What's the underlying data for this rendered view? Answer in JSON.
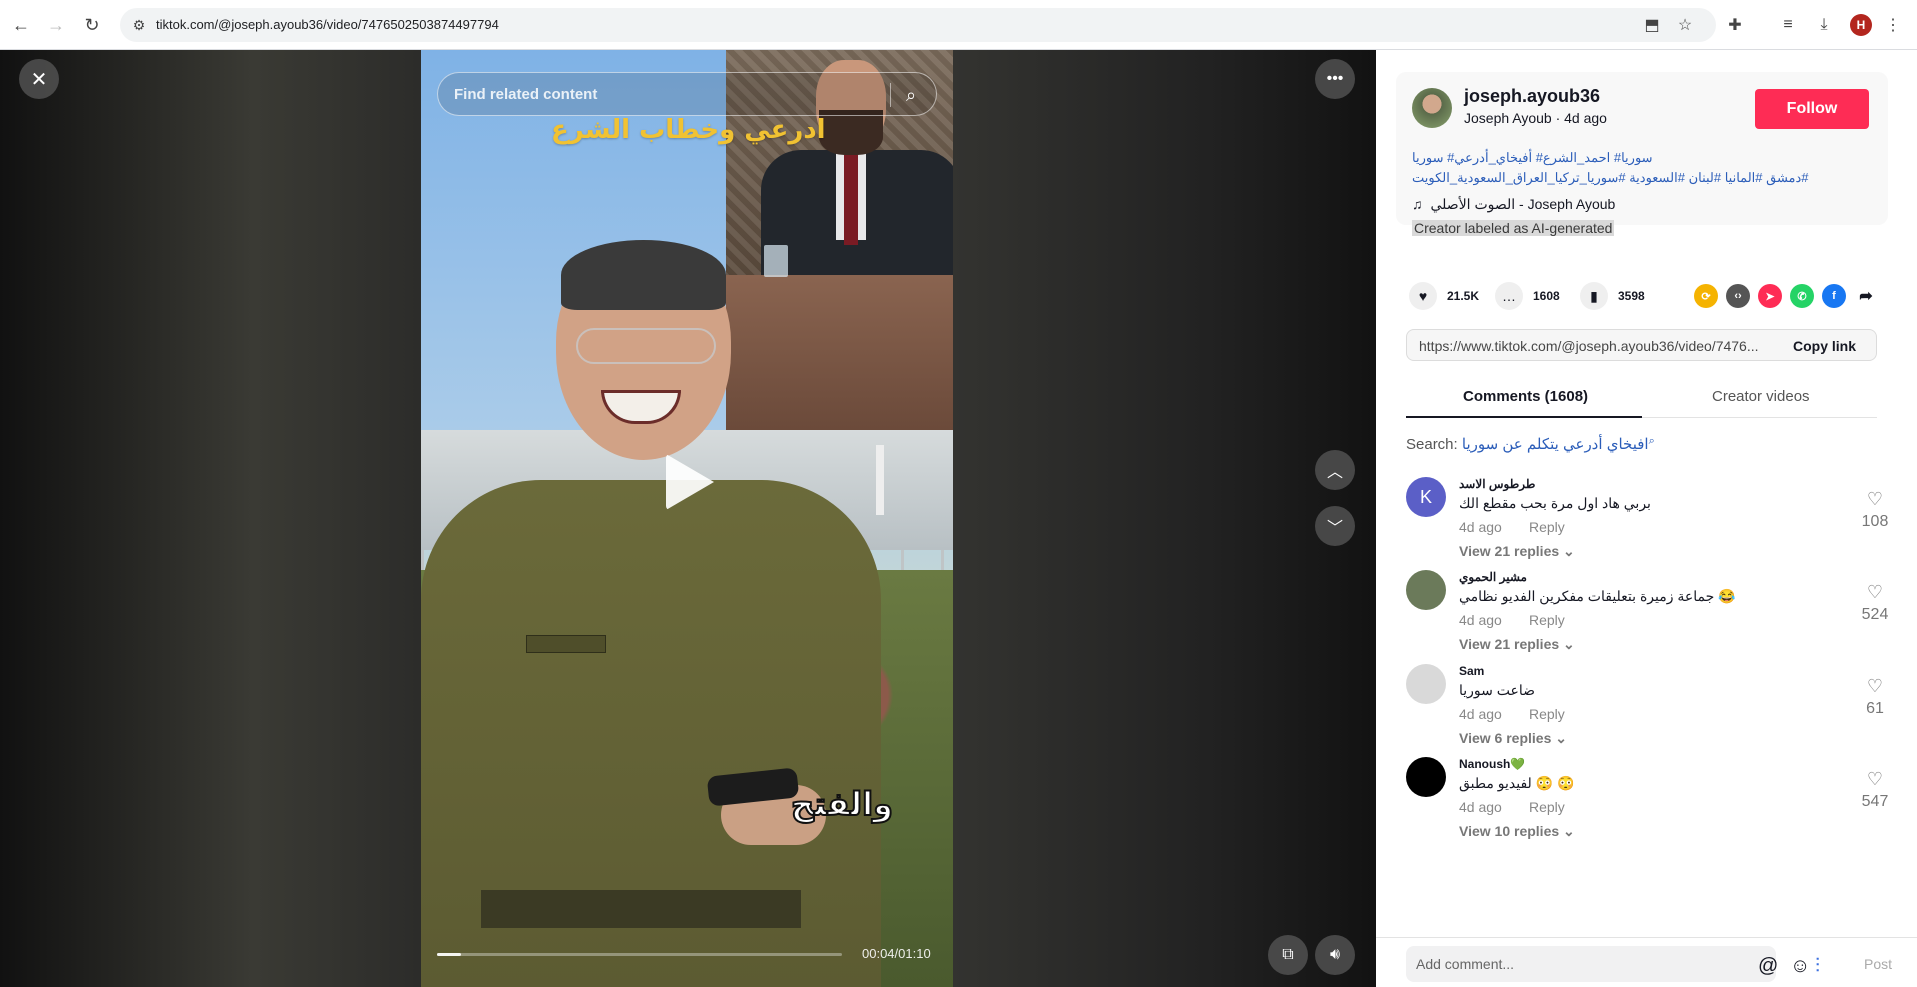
{
  "browser": {
    "url": "tiktok.com/@joseph.ayoub36/video/7476502503874497794",
    "profile_initial": "H"
  },
  "video": {
    "search_placeholder": "Find related content",
    "overlay_top": "ادرعي وخطاب الشرع",
    "overlay_bottom": "والفتح",
    "time": "00:04/01:10",
    "progress_fraction": 0.06
  },
  "creator": {
    "name": "joseph.ayoub36",
    "subtitle": "Joseph Ayoub · 4d ago",
    "follow_label": "Follow",
    "hashtags_line1": "سوريا# احمد_الشرع# أفيخاي_أدرعي# سوريا",
    "hashtags_line2": "#دمشق #المانيا #لبنان #السعودية #سوريا_تركيا_العراق_السعودية_الكويت",
    "music": "الصوت الأصلي - Joseph Ayoub",
    "ai_label": "Creator labeled as AI-generated"
  },
  "stats": {
    "likes": "21.5K",
    "comments": "1608",
    "saves": "3598"
  },
  "share": {
    "link": "https://www.tiktok.com/@joseph.ayoub36/video/7476...",
    "copy_label": "Copy link"
  },
  "tabs": {
    "comments": "Comments (1608)",
    "creator_videos": "Creator videos"
  },
  "search": {
    "prefix": "Search:",
    "query": "افيخاي أدرعي يتكلم عن سوريا"
  },
  "comments": [
    {
      "user": "طرطوس الاسد",
      "text": "بربي هاد اول مرة بحب مقطع الك",
      "date": "4d ago",
      "reply": "Reply",
      "view": "View 21 replies",
      "likes": "108",
      "avatar": "K",
      "avatar_color": "#5b5fc7"
    },
    {
      "user": "مشير الحموي",
      "text": "جماعة زميرة بتعليقات مفكرين الفديو نظامي 😂",
      "date": "4d ago",
      "reply": "Reply",
      "view": "View 21 replies",
      "likes": "524",
      "avatar": "",
      "avatar_color": "#6b7a5a"
    },
    {
      "user": "Sam",
      "text": "ضاعت سوريا",
      "date": "4d ago",
      "reply": "Reply",
      "view": "View 6 replies",
      "likes": "61",
      "avatar": "",
      "avatar_color": "#d9d9d9"
    },
    {
      "user": "Nanoush💚",
      "text": "لفيديو مطبق 😳 😳",
      "date": "4d ago",
      "reply": "Reply",
      "view": "View 10 replies",
      "likes": "547",
      "avatar": "",
      "avatar_color": "#000000"
    }
  ],
  "composer": {
    "placeholder": "Add comment...",
    "post_label": "Post"
  },
  "colors": {
    "follow": "#fe2c55",
    "hashtag": "#2b5db9"
  }
}
